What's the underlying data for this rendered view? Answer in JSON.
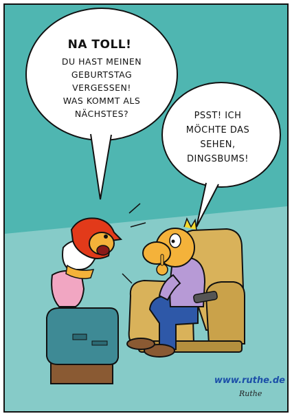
{
  "bubble_left": {
    "heading": "NA TOLL!",
    "text": "DU HAST MEINEN\nGEBURTSTAG\nVERGESSEN!\nWAS KOMMT ALS\nNÄCHSTES?"
  },
  "bubble_right": {
    "text": "PSST! ICH\nMÖCHTE DAS\nSEHEN,\nDINGSBUMS!"
  },
  "footer": {
    "url": "www.ruthe.de",
    "signature": "Ruthe"
  },
  "colors": {
    "background_wall": "#4fb6b1",
    "floor": "#86cbc8",
    "armchair": "#d9b25a",
    "tv_body": "#3e8a95",
    "tv_stand": "#8a5a33",
    "woman_hair": "#e23a1a",
    "woman_skirt": "#f1a6c2",
    "man_shirt": "#b79ad6",
    "man_jeans": "#2e58a8",
    "url_text": "#1b4fa8"
  }
}
